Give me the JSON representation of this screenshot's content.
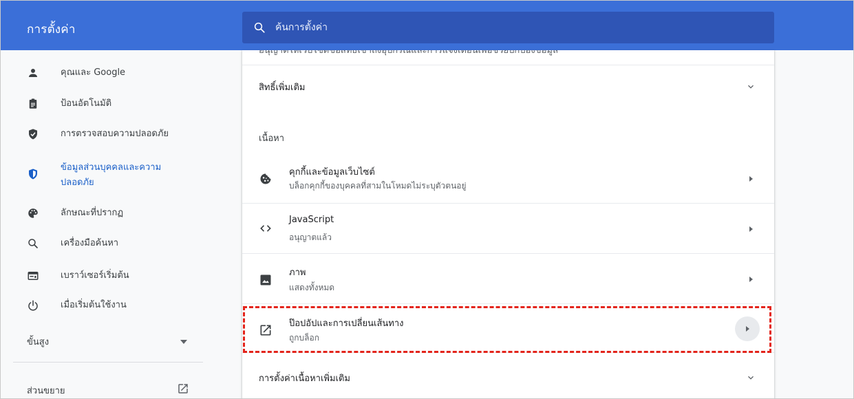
{
  "header": {
    "title": "การตั้งค่า",
    "search_placeholder": "ค้นการตั้งค่า"
  },
  "sidebar": {
    "items": [
      {
        "label": "คุณและ Google",
        "icon": "person-icon"
      },
      {
        "label": "ป้อนอัตโนมัติ",
        "icon": "clipboard-icon"
      },
      {
        "label": "การตรวจสอบความปลอดภัย",
        "icon": "shield-check-icon"
      },
      {
        "label_line1": "ข้อมูลส่วนบุคคลและความ",
        "label_line2": "ปลอดภัย",
        "icon": "shield-privacy-icon",
        "active": true
      },
      {
        "label": "ลักษณะที่ปรากฏ",
        "icon": "palette-icon"
      },
      {
        "label": "เครื่องมือค้นหา",
        "icon": "search-icon"
      },
      {
        "label": "เบราว์เซอร์เริ่มต้น",
        "icon": "browser-icon"
      },
      {
        "label": "เมื่อเริ่มต้นใช้งาน",
        "icon": "power-icon"
      }
    ],
    "advanced": "ขั้นสูง",
    "extensions": "ส่วนขยาย"
  },
  "main": {
    "cutoff_text": "อนุญาตให้เว็บไซต์ขอสิทธิ์เข้าถึงอุปกรณ์และการแจ้งเตือนเพื่อช่วยปกป้องข้อมูล",
    "additional_permissions": "สิทธิ์เพิ่มเติม",
    "content_heading": "เนื้อหา",
    "items": [
      {
        "title": "คุกกี้และข้อมูลเว็บไซต์",
        "subtitle": "บล็อกคุกกี้ของบุคคลที่สามในโหมดไม่ระบุตัวตนอยู่",
        "icon": "cookie-icon"
      },
      {
        "title": "JavaScript",
        "subtitle": "อนุญาตแล้ว",
        "icon": "code-icon"
      },
      {
        "title": "ภาพ",
        "subtitle": "แสดงทั้งหมด",
        "icon": "image-icon"
      },
      {
        "title": "ป๊อปอัปและการเปลี่ยนเส้นทาง",
        "subtitle": "ถูกบล็อก",
        "icon": "open-in-new-icon"
      }
    ],
    "additional_content": "การตั้งค่าเนื้อหาเพิ่มเติม"
  },
  "colors": {
    "header": "#3b6fd8",
    "search_bg": "#2f55b5",
    "active_nav": "#1a5fc8",
    "highlight": "#e3241b"
  }
}
